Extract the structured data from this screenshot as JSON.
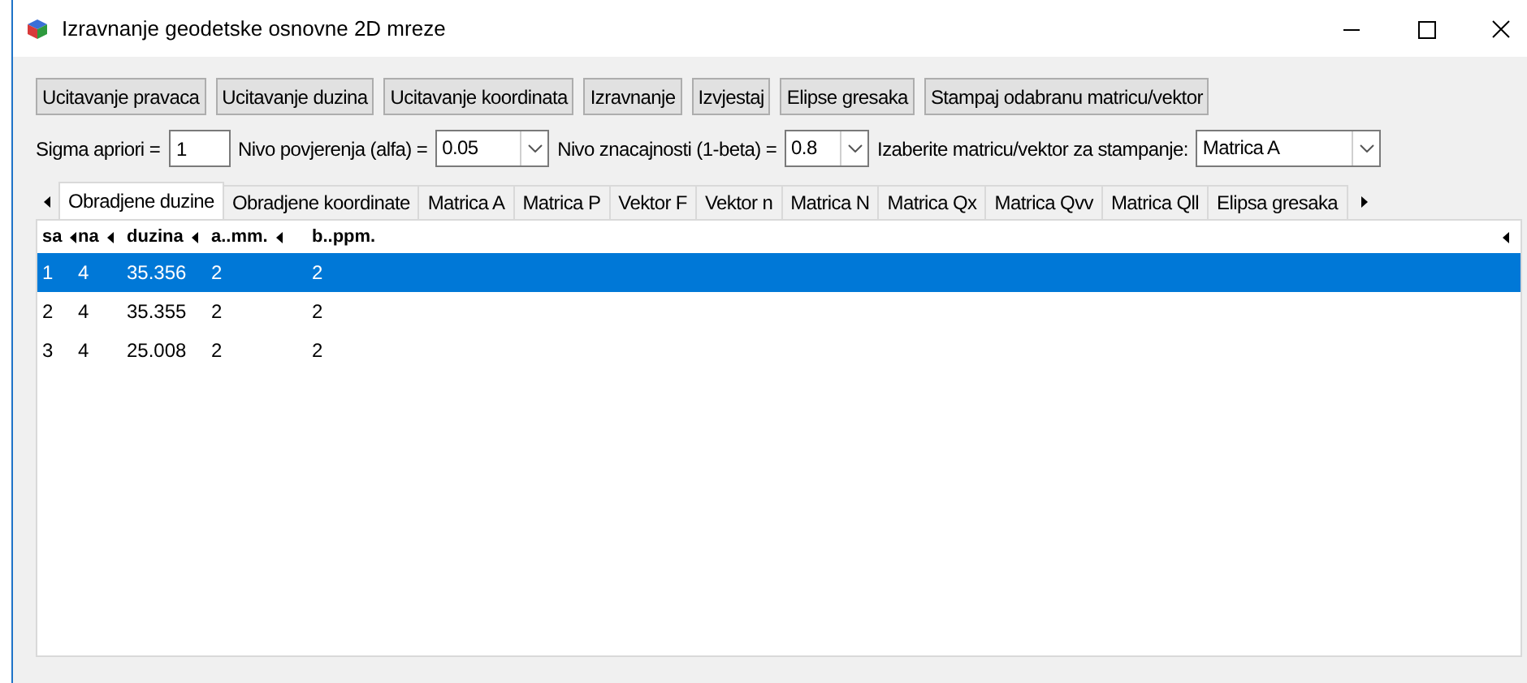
{
  "window": {
    "title": "Izravnanje geodetske osnovne 2D mreze"
  },
  "buttons": [
    "Ucitavanje pravaca",
    "Ucitavanje duzina",
    "Ucitavanje koordinata",
    "Izravnanje",
    "Izvjestaj",
    "Elipse gresaka",
    "Stampaj odabranu matricu/vektor"
  ],
  "parameters": [
    {
      "kind": "field",
      "label": "Sigma apriori =",
      "value": "1"
    },
    {
      "kind": "dropdown",
      "label": "Nivo povjerenja (alfa) =",
      "value": "0.05"
    },
    {
      "kind": "dropdown",
      "label": "Nivo znacajnosti (1-beta) =",
      "value": "0.8"
    },
    {
      "kind": "dropdown",
      "label": "Izaberite matricu/vektor za stampanje:",
      "value": "Matrica A"
    }
  ],
  "tabs": [
    {
      "label": "Obradjene duzine",
      "selected": true
    },
    {
      "label": "Obradjene koordinate",
      "selected": false
    },
    {
      "label": "Matrica A",
      "selected": false
    },
    {
      "label": "Matrica P",
      "selected": false
    },
    {
      "label": "Vektor F",
      "selected": false
    },
    {
      "label": "Vektor n",
      "selected": false
    },
    {
      "label": "Matrica N",
      "selected": false
    },
    {
      "label": "Matrica Qx",
      "selected": false
    },
    {
      "label": "Matrica Qvv",
      "selected": false
    },
    {
      "label": "Matrica Qll",
      "selected": false
    },
    {
      "label": "Elipsa gresaka",
      "selected": false
    }
  ],
  "table": {
    "columns": [
      "sa",
      "na",
      "duzina",
      "a..mm.",
      "b..ppm."
    ],
    "rows": [
      {
        "cells": [
          "1",
          "4",
          "35.356",
          "2",
          "2"
        ],
        "selected": true
      },
      {
        "cells": [
          "2",
          "4",
          "35.355",
          "2",
          "2"
        ],
        "selected": false
      },
      {
        "cells": [
          "3",
          "4",
          "25.008",
          "2",
          "2"
        ],
        "selected": false
      }
    ]
  }
}
